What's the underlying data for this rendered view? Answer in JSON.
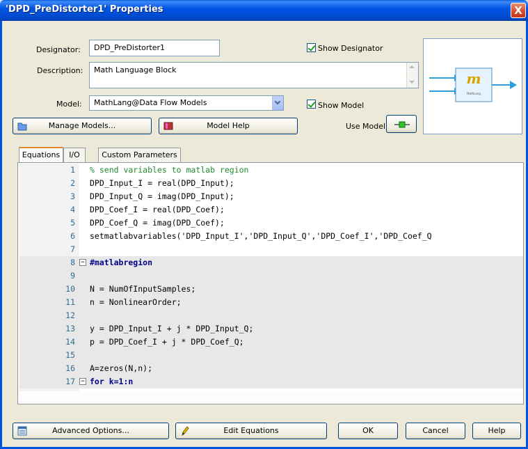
{
  "window": {
    "title": "'DPD_PreDistorter1' Properties",
    "close_glyph": "X"
  },
  "designator": {
    "label": "Designator:",
    "value": "DPD_PreDistorter1"
  },
  "description": {
    "label": "Description:",
    "value": "Math Language Block"
  },
  "model": {
    "label": "Model:",
    "value": "MathLang@Data Flow Models"
  },
  "show_designator": {
    "label": "Show Designator",
    "checked": true
  },
  "show_model": {
    "label": "Show Model",
    "checked": true
  },
  "use_model": {
    "label": "Use Model"
  },
  "buttons": {
    "manage_models": "Manage Models...",
    "model_help": "Model Help",
    "advanced_options": "Advanced Options...",
    "edit_equations": "Edit Equations",
    "ok": "OK",
    "cancel": "Cancel",
    "help": "Help"
  },
  "preview": {
    "symbol_glyph": "m",
    "symbol_label": "MathLang"
  },
  "tabs": [
    {
      "label": "Equations",
      "active": true
    },
    {
      "label": "I/O",
      "active": false
    },
    {
      "label": "Custom Parameters",
      "active": false
    }
  ],
  "code_lines": [
    {
      "num": "1",
      "text": "% send variables to matlab region"
    },
    {
      "num": "2",
      "text": "DPD_Input_I = real(DPD_Input);"
    },
    {
      "num": "3",
      "text": "DPD_Input_Q = imag(DPD_Input);"
    },
    {
      "num": "4",
      "text": "DPD_Coef_I = real(DPD_Coef);"
    },
    {
      "num": "5",
      "text": "DPD_Coef_Q = imag(DPD_Coef);"
    },
    {
      "num": "6",
      "text": "setmatlabvariables('DPD_Input_I','DPD_Input_Q','DPD_Coef_I','DPD_Coef_Q"
    },
    {
      "num": "7",
      "text": ""
    },
    {
      "num": "8",
      "text": "#matlabregion"
    },
    {
      "num": "9",
      "text": ""
    },
    {
      "num": "10",
      "text": "N = NumOfInputSamples;"
    },
    {
      "num": "11",
      "text": "n = NonlinearOrder;"
    },
    {
      "num": "12",
      "text": ""
    },
    {
      "num": "13",
      "text": "y = DPD_Input_I + j * DPD_Input_Q;"
    },
    {
      "num": "14",
      "text": "p = DPD_Coef_I + j * DPD_Coef_Q;"
    },
    {
      "num": "15",
      "text": ""
    },
    {
      "num": "16",
      "text": "A=zeros(N,n);"
    },
    {
      "num": "17",
      "text": "for k=1:n"
    }
  ]
}
